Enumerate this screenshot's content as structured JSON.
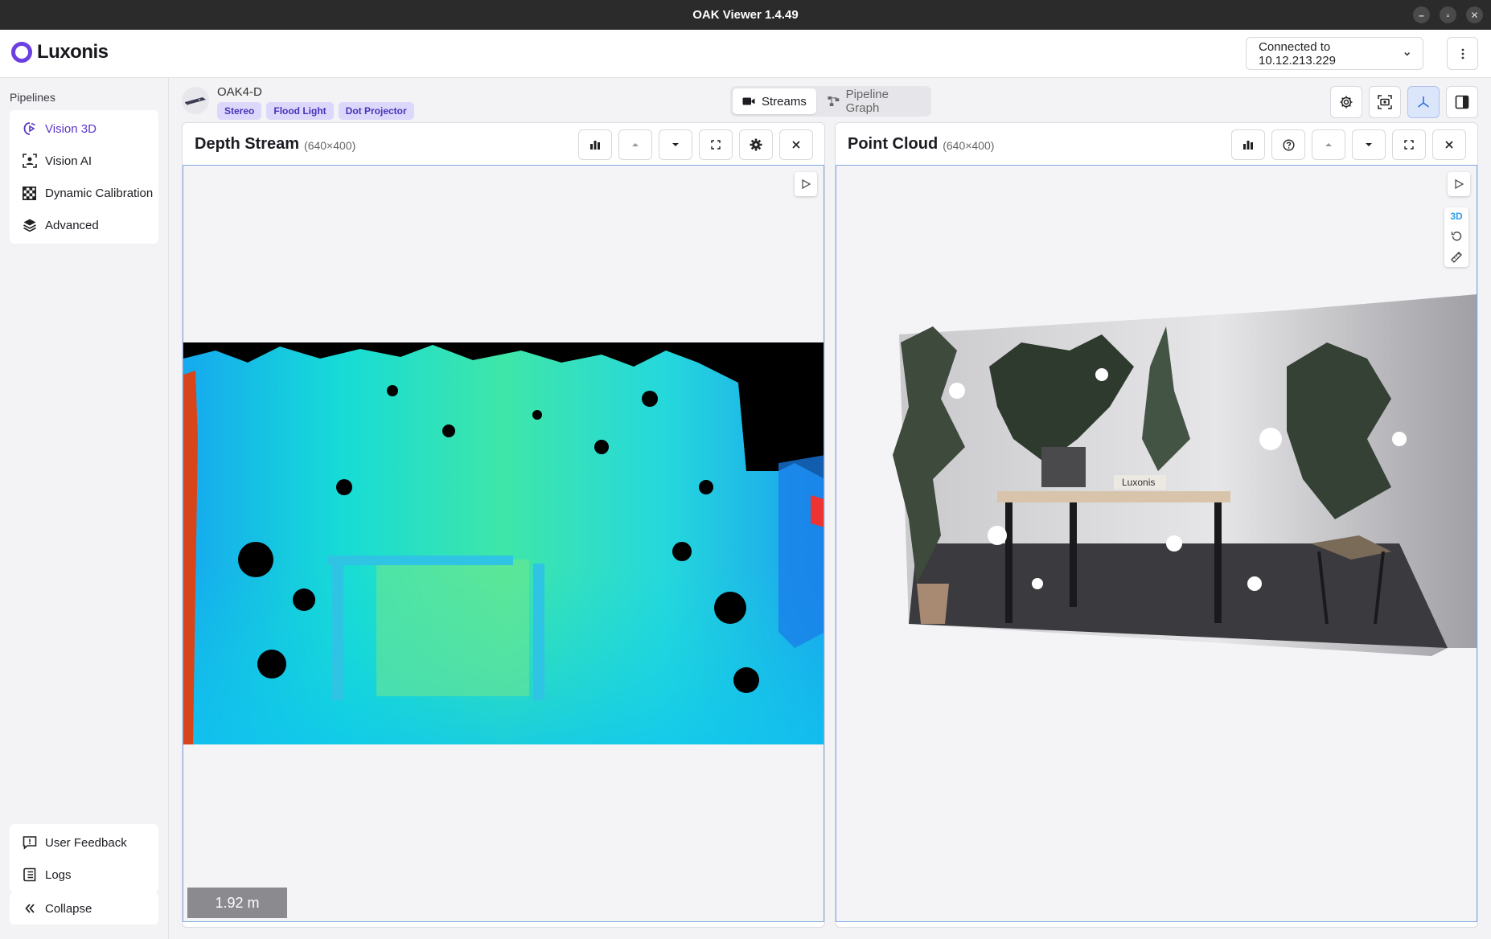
{
  "window": {
    "title": "OAK Viewer 1.4.49"
  },
  "header": {
    "brand": "Luxonis",
    "connection": "Connected to 10.12.213.229"
  },
  "sidebar": {
    "heading": "Pipelines",
    "pipelines": [
      {
        "label": "Vision 3D",
        "icon": "vision-3d-icon",
        "active": true
      },
      {
        "label": "Vision AI",
        "icon": "person-frame-icon",
        "active": false
      },
      {
        "label": "Dynamic Calibration",
        "icon": "checkerboard-icon",
        "active": false
      },
      {
        "label": "Advanced",
        "icon": "layers-icon",
        "active": false
      }
    ],
    "footer": [
      {
        "label": "User Feedback",
        "icon": "feedback-icon"
      },
      {
        "label": "Logs",
        "icon": "logs-icon"
      }
    ],
    "collapse": "Collapse"
  },
  "device": {
    "name": "OAK4-D",
    "chips": [
      "Stereo",
      "Flood Light",
      "Dot Projector"
    ]
  },
  "view_tabs": {
    "streams": "Streams",
    "graph": "Pipeline Graph"
  },
  "panels": {
    "depth": {
      "title": "Depth Stream",
      "resolution": "(640×400)",
      "distance": "1.92 m"
    },
    "cloud": {
      "title": "Point Cloud",
      "resolution": "(640×400)",
      "mode": "3D"
    }
  },
  "colors": {
    "accent": "#5a35c9",
    "chip_bg": "#dcd8fb",
    "focus": "#7fa7e4"
  }
}
